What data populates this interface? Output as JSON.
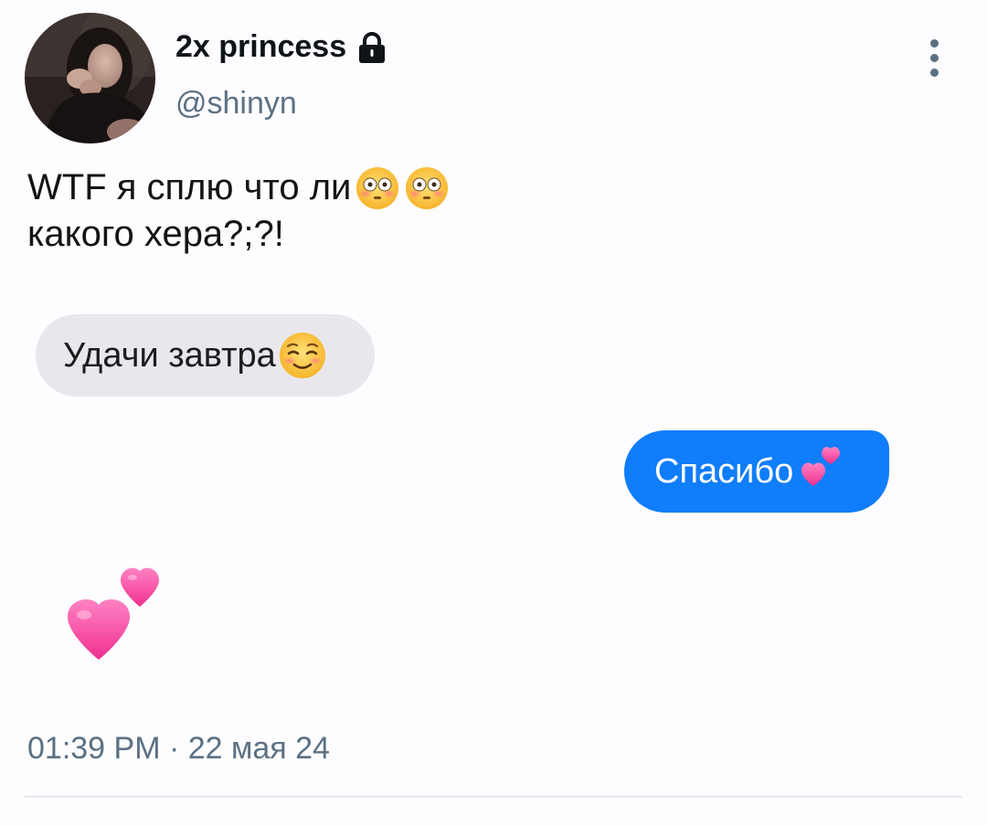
{
  "author": {
    "display_name": "2x princess",
    "handle": "@shinyn",
    "protected_icon": "lock-icon",
    "avatar": "avatar-photo"
  },
  "menu": {
    "icon": "more-vertical-icon"
  },
  "tweet": {
    "line1": "WTF я сплю что ли",
    "line1_emojis": [
      "flushed-face-emoji",
      "flushed-face-emoji"
    ],
    "line2": "какого хера?;?!"
  },
  "messages": [
    {
      "side": "incoming",
      "text": "Удачи завтра",
      "emoji": "relieved-face-emoji",
      "color": "#e9e7ed"
    },
    {
      "side": "outgoing",
      "text": "Спасибо",
      "emoji": "two-hearts-emoji",
      "color": "#107dfb"
    }
  ],
  "reaction_emoji": "two-hearts-emoji",
  "timestamp": "01:39 PM · 22 мая 24",
  "colors": {
    "secondary_text": "#5b7083",
    "outgoing_bubble": "#107dfb",
    "incoming_bubble": "#e9e7ed"
  }
}
